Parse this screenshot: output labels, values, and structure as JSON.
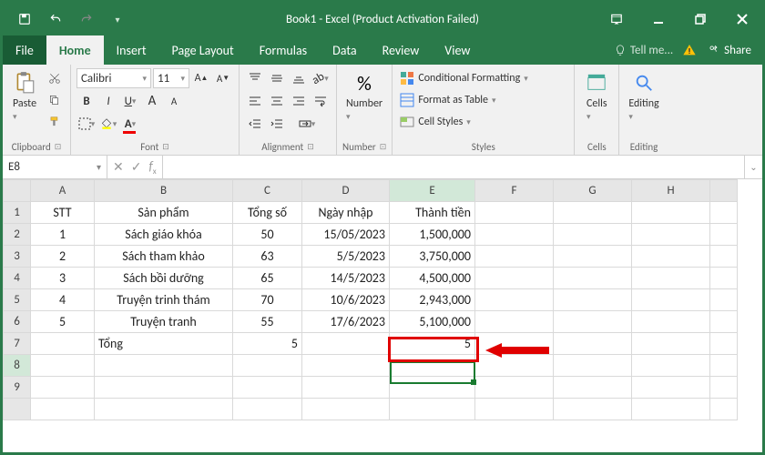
{
  "title": "Book1 - Excel (Product Activation Failed)",
  "qat": {
    "save": "save-icon",
    "undo": "undo-icon",
    "redo": "redo-icon"
  },
  "tabs": {
    "file": "File",
    "home": "Home",
    "insert": "Insert",
    "page_layout": "Page Layout",
    "formulas": "Formulas",
    "data": "Data",
    "review": "Review",
    "view": "View",
    "tell_me": "Tell me...",
    "share": "Share"
  },
  "ribbon": {
    "clipboard": {
      "paste": "Paste",
      "label": "Clipboard"
    },
    "font": {
      "name": "Calibri",
      "size": "11",
      "label": "Font"
    },
    "alignment": {
      "label": "Alignment"
    },
    "number": {
      "pct": "%",
      "label": "Number"
    },
    "styles": {
      "cond": "Conditional Formatting",
      "table": "Format as Table",
      "cell": "Cell Styles",
      "label": "Styles"
    },
    "cells": {
      "label": "Cells"
    },
    "editing": {
      "label": "Editing"
    }
  },
  "namebox": "E8",
  "formula": "",
  "cols": [
    "A",
    "B",
    "C",
    "D",
    "E",
    "F",
    "G",
    "H"
  ],
  "headers": {
    "A": "STT",
    "B": "Sản phẩm",
    "C": "Tổng số",
    "D": "Ngày nhập",
    "E": "Thành tiền"
  },
  "rows": [
    {
      "A": "1",
      "B": "Sách giáo khóa",
      "C": "50",
      "D": "15/05/2023",
      "E": "1,500,000"
    },
    {
      "A": "2",
      "B": "Sách tham khảo",
      "C": "63",
      "D": "5/5/2023",
      "E": "3,750,000"
    },
    {
      "A": "3",
      "B": "Sách bồi dưỡng",
      "C": "65",
      "D": "14/5/2023",
      "E": "4,500,000"
    },
    {
      "A": "4",
      "B": "Truyện trinh thám",
      "C": "70",
      "D": "10/6/2023",
      "E": "2,943,000"
    },
    {
      "A": "5",
      "B": "Truyện tranh",
      "C": "55",
      "D": "17/6/2023",
      "E": "5,100,000"
    }
  ],
  "total_row": {
    "B": "Tổng",
    "C": "5",
    "E": "5"
  }
}
